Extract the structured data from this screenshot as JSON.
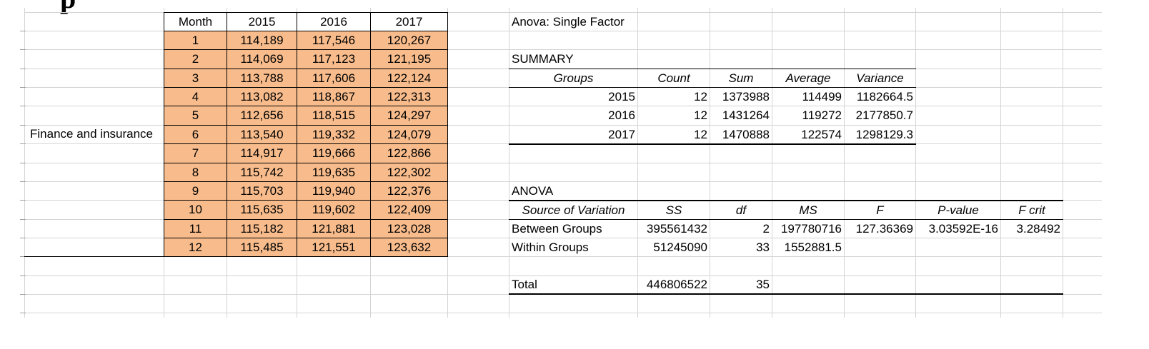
{
  "row_label": "Finance and insurance",
  "corner_text": "p",
  "month_table": {
    "headers": [
      "Month",
      "2015",
      "2016",
      "2017"
    ],
    "rows": [
      [
        "1",
        "114,189",
        "117,546",
        "120,267"
      ],
      [
        "2",
        "114,069",
        "117,123",
        "121,195"
      ],
      [
        "3",
        "113,788",
        "117,606",
        "122,124"
      ],
      [
        "4",
        "113,082",
        "118,867",
        "122,313"
      ],
      [
        "5",
        "112,656",
        "118,515",
        "124,297"
      ],
      [
        "6",
        "113,540",
        "119,332",
        "124,079"
      ],
      [
        "7",
        "114,917",
        "119,666",
        "122,866"
      ],
      [
        "8",
        "115,742",
        "119,635",
        "122,302"
      ],
      [
        "9",
        "115,703",
        "119,940",
        "122,376"
      ],
      [
        "10",
        "115,635",
        "119,602",
        "122,409"
      ],
      [
        "11",
        "115,182",
        "121,881",
        "123,028"
      ],
      [
        "12",
        "115,485",
        "121,551",
        "123,632"
      ]
    ]
  },
  "anova": {
    "title": "Anova: Single Factor",
    "summary_label": "SUMMARY",
    "summary_headers": [
      "Groups",
      "Count",
      "Sum",
      "Average",
      "Variance"
    ],
    "summary_rows": [
      [
        "2015",
        "12",
        "1373988",
        "114499",
        "1182664.5"
      ],
      [
        "2016",
        "12",
        "1431264",
        "119272",
        "2177850.7"
      ],
      [
        "2017",
        "12",
        "1470888",
        "122574",
        "1298129.3"
      ]
    ],
    "anova_label": "ANOVA",
    "anova_headers": [
      "Source of Variation",
      "SS",
      "df",
      "MS",
      "F",
      "P-value",
      "F crit"
    ],
    "between": [
      "Between Groups",
      "395561432",
      "2",
      "197780716",
      "127.36369",
      "3.03592E-16",
      "3.28492"
    ],
    "within": [
      "Within Groups",
      "51245090",
      "33",
      "1552881.5",
      "",
      "",
      ""
    ],
    "total": [
      "Total",
      "446806522",
      "35",
      "",
      "",
      "",
      ""
    ]
  },
  "colors": {
    "month_fill": "#f8bc8c",
    "gridline": "#d4d4d4",
    "border": "#000000"
  }
}
